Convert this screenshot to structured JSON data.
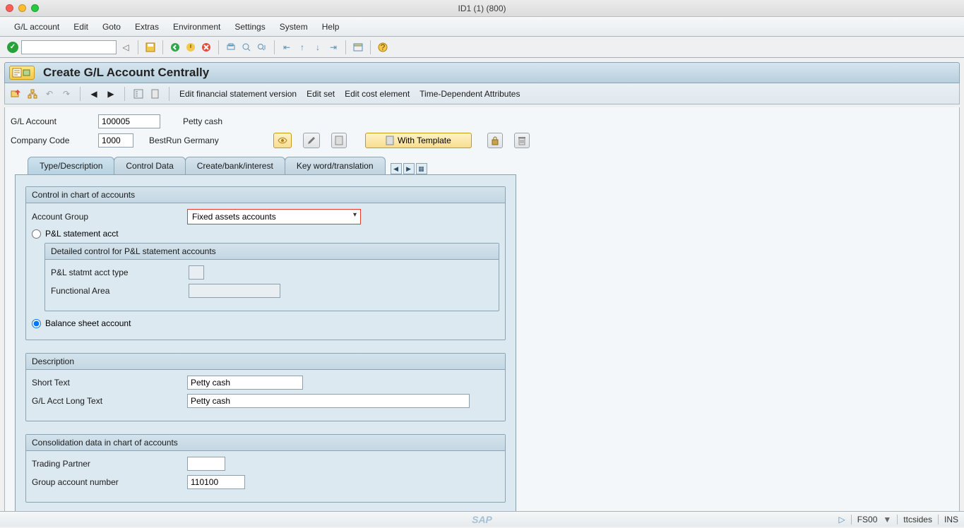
{
  "window": {
    "title": "ID1 (1) (800)"
  },
  "menu": [
    "G/L account",
    "Edit",
    "Goto",
    "Extras",
    "Environment",
    "Settings",
    "System",
    "Help"
  ],
  "page": {
    "title": "Create G/L Account Centrally"
  },
  "subtoolbar": {
    "links": [
      "Edit financial statement version",
      "Edit set",
      "Edit cost element",
      "Time-Dependent Attributes"
    ]
  },
  "header": {
    "gl_label": "G/L Account",
    "gl_value": "100005",
    "gl_desc": "Petty cash",
    "cc_label": "Company Code",
    "cc_value": "1000",
    "cc_desc": "BestRun Germany",
    "with_template": "With Template"
  },
  "tabs": [
    "Type/Description",
    "Control Data",
    "Create/bank/interest",
    "Key word/translation"
  ],
  "group1": {
    "title": "Control in chart of accounts",
    "account_group_label": "Account Group",
    "account_group_value": "Fixed assets accounts",
    "radio_pl": "P&L statement acct",
    "nested_title": "Detailed control for P&L statement accounts",
    "pl_type_label": "P&L statmt acct type",
    "func_area_label": "Functional Area",
    "radio_bs": "Balance sheet account"
  },
  "group2": {
    "title": "Description",
    "short_label": "Short Text",
    "short_value": "Petty cash",
    "long_label": "G/L Acct Long Text",
    "long_value": "Petty cash"
  },
  "group3": {
    "title": "Consolidation data in chart of accounts",
    "tp_label": "Trading Partner",
    "gan_label": "Group account number",
    "gan_value": "110100"
  },
  "status": {
    "tcode": "FS00",
    "user": "ttcsides",
    "mode": "INS",
    "sap": "SAP"
  }
}
